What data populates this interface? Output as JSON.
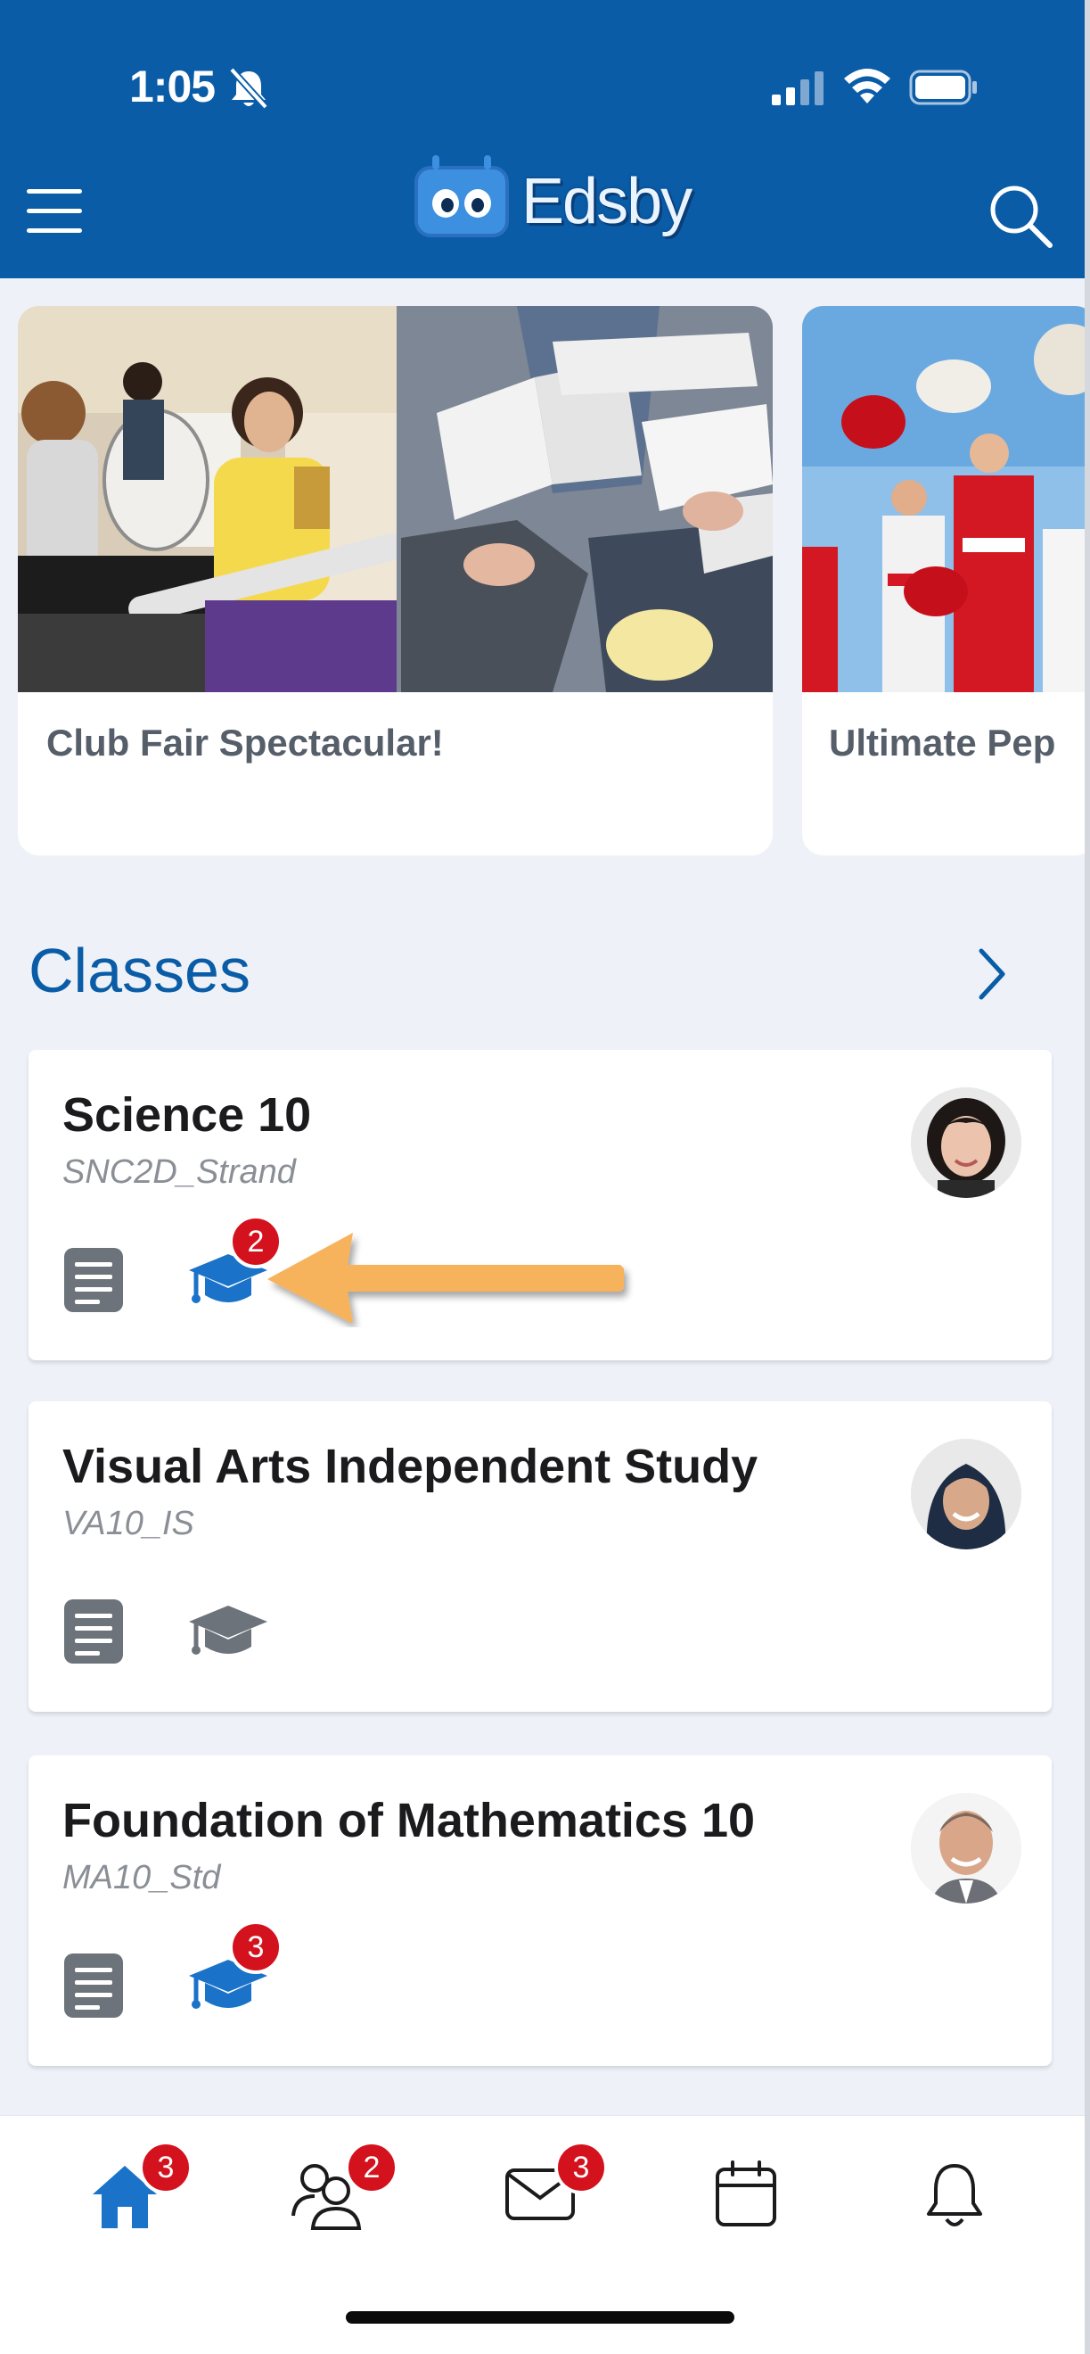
{
  "status_bar": {
    "time": "1:05"
  },
  "header": {
    "logo_text": "Edsby",
    "brand_color": "#0a5ca7"
  },
  "featured": [
    {
      "title": "Club Fair Spectacular!"
    },
    {
      "title": "Ultimate Pep"
    }
  ],
  "classes_section": {
    "title": "Classes"
  },
  "classes": [
    {
      "name": "Science 10",
      "code": "SNC2D_Strand",
      "grades_badge": "2",
      "grades_active": true
    },
    {
      "name": "Visual Arts Independent Study",
      "code": "VA10_IS",
      "grades_badge": "",
      "grades_active": false
    },
    {
      "name": "Foundation of Mathematics 10",
      "code": "MA10_Std",
      "grades_badge": "3",
      "grades_active": true
    }
  ],
  "tabbar": {
    "home_badge": "3",
    "people_badge": "2",
    "messages_badge": "3"
  },
  "colors": {
    "accent": "#0a5ca7",
    "badge": "#d4121e",
    "arrow": "#f7b25c",
    "icon_gray": "#6d737a"
  }
}
